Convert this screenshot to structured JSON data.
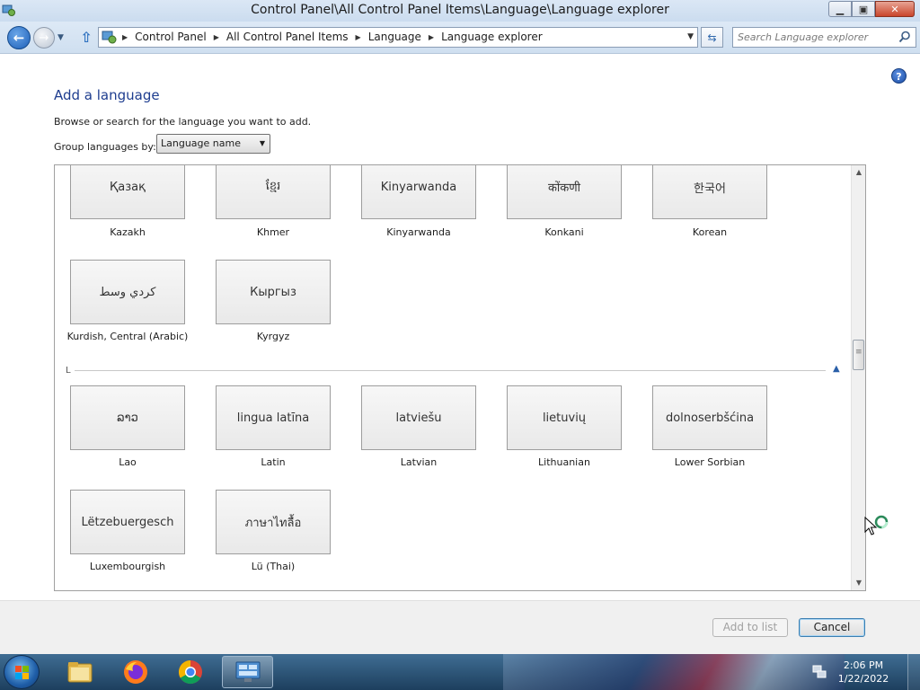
{
  "window": {
    "title": "Control Panel\\All Control Panel Items\\Language\\Language explorer",
    "min_glyph": "▁",
    "max_glyph": "▣",
    "close_glyph": "✕"
  },
  "nav": {
    "breadcrumbs": [
      "Control Panel",
      "All Control Panel Items",
      "Language",
      "Language explorer"
    ],
    "search_placeholder": "Search Language explorer"
  },
  "page": {
    "title": "Add a language",
    "instruction": "Browse or search for the language you want to add.",
    "group_label": "Group languages by:",
    "group_value": "Language name"
  },
  "groups": {
    "k": {
      "row1": [
        {
          "native": "Қазақ",
          "name": "Kazakh"
        },
        {
          "native": "ខ្មែរ",
          "name": "Khmer"
        },
        {
          "native": "Kinyarwanda",
          "name": "Kinyarwanda"
        },
        {
          "native": "कोंकणी",
          "name": "Konkani"
        },
        {
          "native": "한국어",
          "name": "Korean"
        }
      ],
      "row2": [
        {
          "native": "كردي وسط",
          "name": "Kurdish, Central (Arabic)"
        },
        {
          "native": "Кыргыз",
          "name": "Kyrgyz"
        }
      ]
    },
    "l": {
      "letter": "L",
      "row1": [
        {
          "native": "ລາວ",
          "name": "Lao"
        },
        {
          "native": "lingua latīna",
          "name": "Latin"
        },
        {
          "native": "latviešu",
          "name": "Latvian"
        },
        {
          "native": "lietuvių",
          "name": "Lithuanian"
        },
        {
          "native": "dolnoserbšćina",
          "name": "Lower Sorbian"
        }
      ],
      "row2": [
        {
          "native": "Lëtzebuergesch",
          "name": "Luxembourgish"
        },
        {
          "native": "ภาษาไทลื้อ",
          "name": "Lü (Thai)"
        }
      ]
    }
  },
  "buttons": {
    "add": "Add to list",
    "cancel": "Cancel"
  },
  "taskbar": {
    "time": "2:06 PM",
    "date": "1/22/2022"
  },
  "colors": {
    "accent": "#1e3d8f",
    "taskbar": "#2a5478"
  }
}
